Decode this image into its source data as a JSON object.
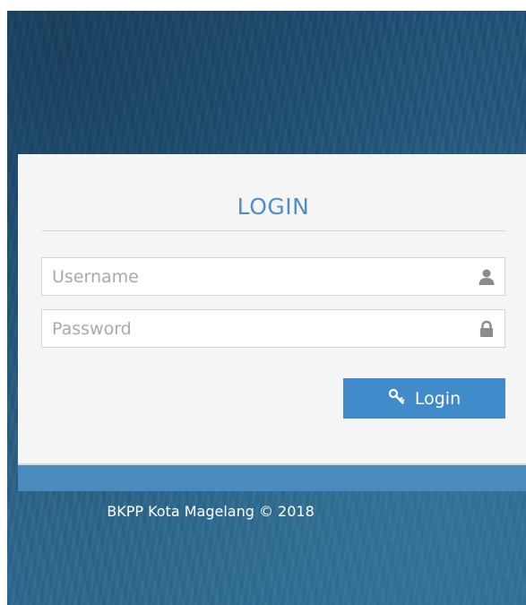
{
  "login": {
    "title": "LOGIN",
    "username": {
      "placeholder": "Username",
      "value": "",
      "icon": "user-icon"
    },
    "password": {
      "placeholder": "Password",
      "value": "",
      "icon": "lock-icon"
    },
    "submit": {
      "label": "Login",
      "icon": "key-icon"
    }
  },
  "footer": {
    "copyright": "BKPP Kota Magelang © 2018"
  },
  "colors": {
    "accent": "#428bca",
    "title": "#4f8fc6",
    "background": "#245a80",
    "panel": "#f5f5f6",
    "footer_bar": "#4a8bbd"
  }
}
